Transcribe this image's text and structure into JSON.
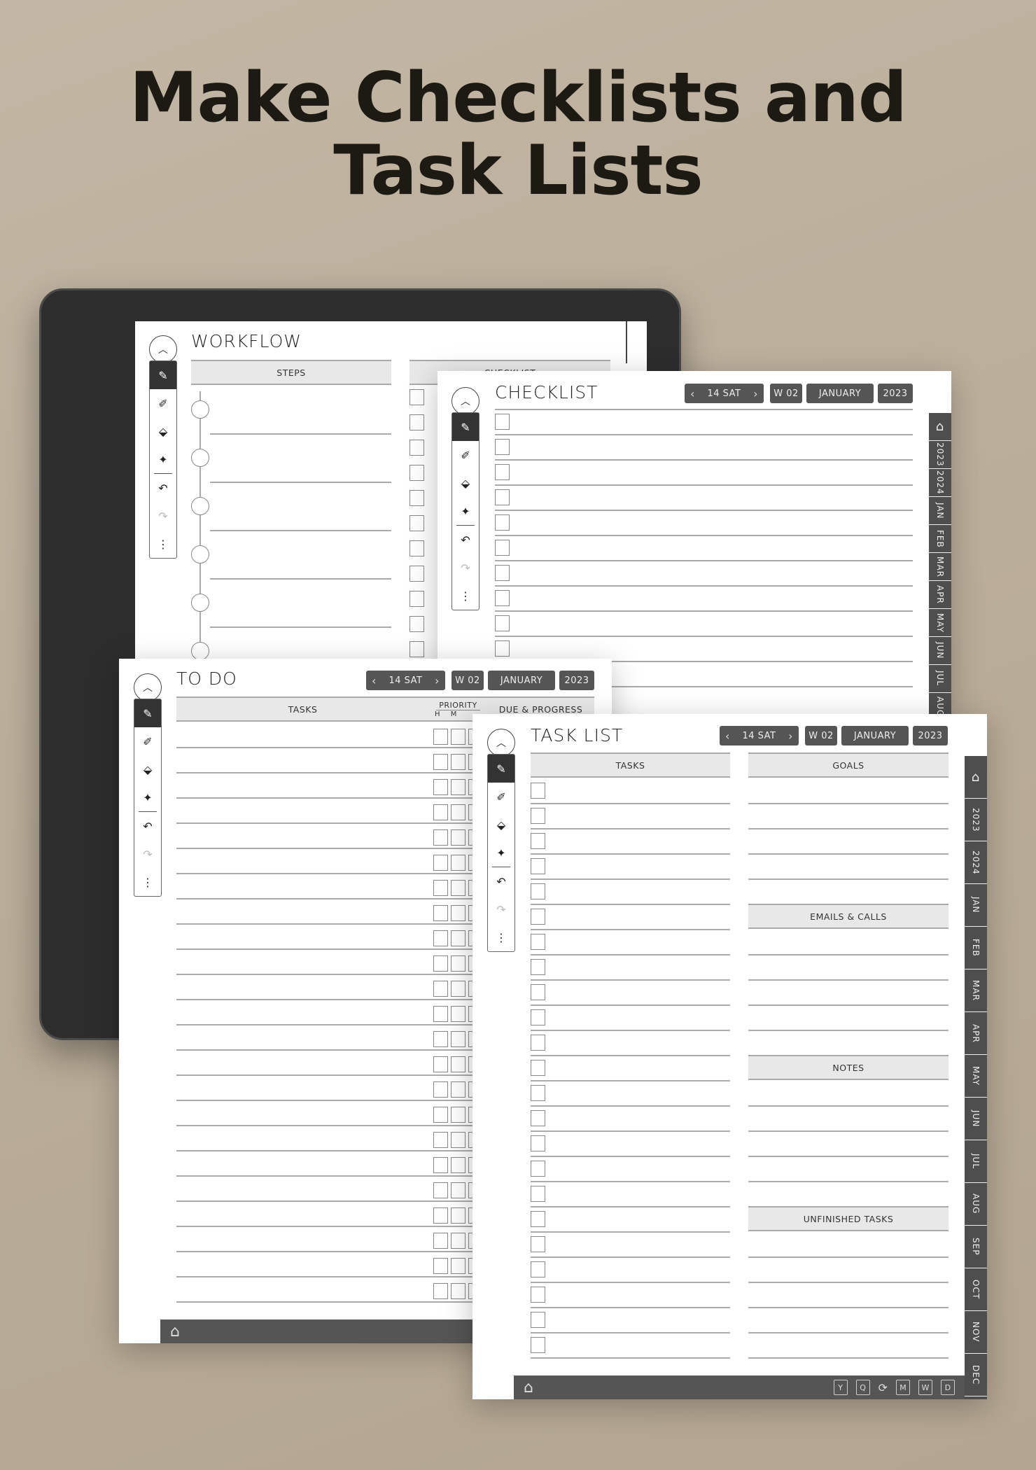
{
  "headline": "Make Checklists and Task Lists",
  "nav": {
    "day": "14 SAT",
    "week": "W 02",
    "month": "JANUARY",
    "year": "2023"
  },
  "side_tabs": [
    "2023",
    "2024",
    "JAN",
    "FEB",
    "MAR",
    "APR",
    "MAY",
    "JUN",
    "JUL",
    "AUG",
    "SEP",
    "OCT",
    "NOV",
    "DEC"
  ],
  "bottom_icons": [
    "Y",
    "Q",
    "M",
    "W",
    "D"
  ],
  "workflow": {
    "title": "WORKFLOW",
    "steps": "STEPS",
    "checklist": "CHECKLIST"
  },
  "checklist": {
    "title": "CHECKLIST"
  },
  "todo": {
    "title": "TO DO",
    "tasks": "TASKS",
    "priority": "PRIORITY",
    "h": "H",
    "m": "M",
    "due": "DUE & PROGRESS"
  },
  "tasklist": {
    "title": "TASK LIST",
    "tasks": "TASKS",
    "goals": "GOALS",
    "emails": "EMAILS & CALLS",
    "notes": "NOTES",
    "unfinished": "UNFINISHED TASKS"
  },
  "colors": {
    "background": "#bcb09e",
    "bar": "#555555",
    "headline": "#1d1913"
  }
}
